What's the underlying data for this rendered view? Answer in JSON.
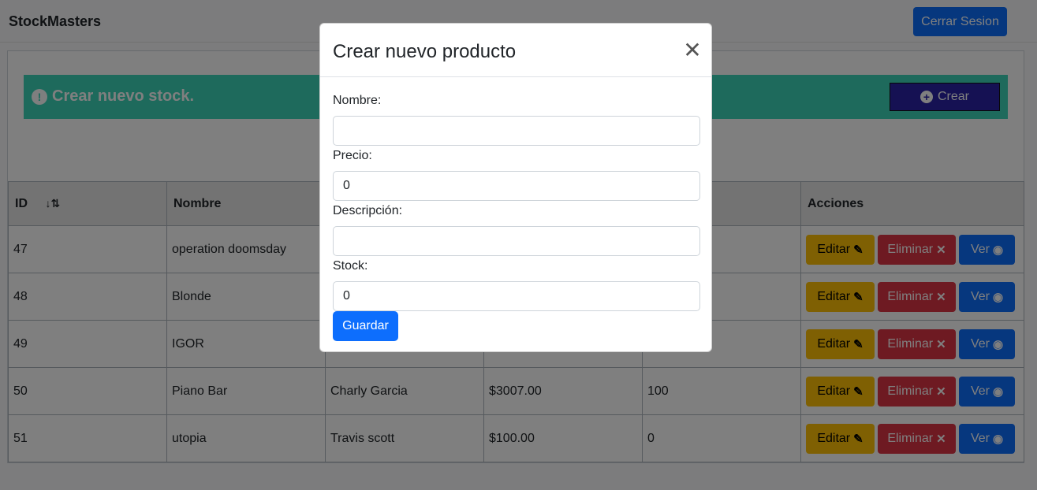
{
  "navbar": {
    "brand": "StockMasters",
    "logout_label": "Cerrar Sesion"
  },
  "banner": {
    "message": "Crear nuevo stock.",
    "create_label": "Crear",
    "bg_color": "#3dd5b9"
  },
  "table": {
    "headers": {
      "id": "ID",
      "name": "Nombre",
      "actions": "Acciones"
    },
    "rows": [
      {
        "id": "47",
        "name": "operation doomsday",
        "artist": "",
        "price": "",
        "stock": ""
      },
      {
        "id": "48",
        "name": "Blonde",
        "artist": "",
        "price": "",
        "stock": ""
      },
      {
        "id": "49",
        "name": "IGOR",
        "artist": "",
        "price": "",
        "stock": ""
      },
      {
        "id": "50",
        "name": "Piano Bar",
        "artist": "Charly Garcia",
        "price": "$3007.00",
        "stock": "100"
      },
      {
        "id": "51",
        "name": "utopia",
        "artist": "Travis scott",
        "price": "$100.00",
        "stock": "0"
      }
    ],
    "action_labels": {
      "edit": "Editar",
      "delete": "Eliminar",
      "view": "Ver"
    }
  },
  "modal": {
    "title": "Crear nuevo producto",
    "fields": [
      {
        "label": "Nombre:",
        "value": ""
      },
      {
        "label": "Precio:",
        "value": "0"
      },
      {
        "label": "Descripción:",
        "value": ""
      },
      {
        "label": "Stock:",
        "value": "0"
      }
    ],
    "save_label": "Guardar"
  }
}
